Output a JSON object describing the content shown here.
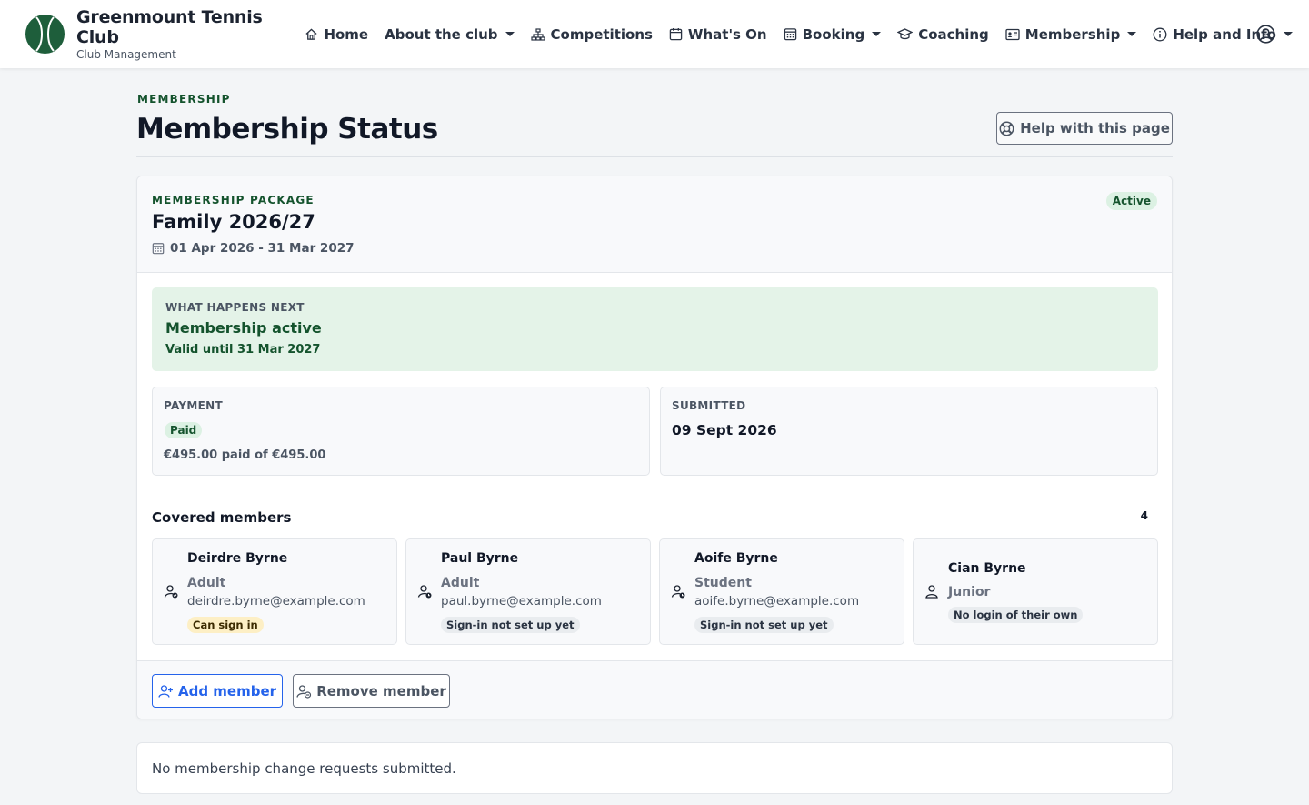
{
  "brand": {
    "title": "Greenmount Tennis Club",
    "subtitle": "Club Management"
  },
  "nav": [
    {
      "label": "Home",
      "icon": "home-icon",
      "dropdown": false
    },
    {
      "label": "About the club",
      "icon": "",
      "dropdown": true
    },
    {
      "label": "Competitions",
      "icon": "sitemap-icon",
      "dropdown": false
    },
    {
      "label": "What's On",
      "icon": "calendar-icon",
      "dropdown": false
    },
    {
      "label": "Booking",
      "icon": "grid-calendar-icon",
      "dropdown": true
    },
    {
      "label": "Coaching",
      "icon": "graduation-cap-icon",
      "dropdown": false
    },
    {
      "label": "Membership",
      "icon": "id-card-icon",
      "dropdown": true
    },
    {
      "label": "Help and Info",
      "icon": "info-circle-icon",
      "dropdown": true
    }
  ],
  "header": {
    "eyebrow": "MEMBERSHIP",
    "title": "Membership Status",
    "help_label": "Help with this page"
  },
  "package": {
    "eyebrow": "MEMBERSHIP PACKAGE",
    "name": "Family 2026/27",
    "dates": "01 Apr 2026 - 31 Mar 2027",
    "status": "Active"
  },
  "next": {
    "eyebrow": "WHAT HAPPENS NEXT",
    "title": "Membership active",
    "subtitle": "Valid until 31 Mar 2027"
  },
  "payment": {
    "label": "PAYMENT",
    "status": "Paid",
    "amount": "€495.00 paid of €495.00"
  },
  "submitted": {
    "label": "SUBMITTED",
    "date": "09 Sept 2026"
  },
  "covered": {
    "title": "Covered members",
    "count": "4",
    "members": [
      {
        "name": "Deirdre Byrne",
        "type": "Adult",
        "email": "deirdre.byrne@example.com",
        "badge": "Can sign in"
      },
      {
        "name": "Paul Byrne",
        "type": "Adult",
        "email": "paul.byrne@example.com",
        "badge": "Sign-in not set up yet"
      },
      {
        "name": "Aoife Byrne",
        "type": "Student",
        "email": "aoife.byrne@example.com",
        "badge": "Sign-in not set up yet"
      },
      {
        "name": "Cian Byrne",
        "type": "Junior",
        "email": "",
        "badge": "No login of their own"
      }
    ]
  },
  "actions": {
    "add_label": "Add member",
    "remove_label": "Remove member"
  },
  "requests": {
    "empty_text": "No membership change requests submitted."
  },
  "colors": {
    "brand": "#1e5e3b",
    "accent": "#2563eb",
    "success_bg": "#e4f3e8",
    "success_text": "#14532d"
  }
}
